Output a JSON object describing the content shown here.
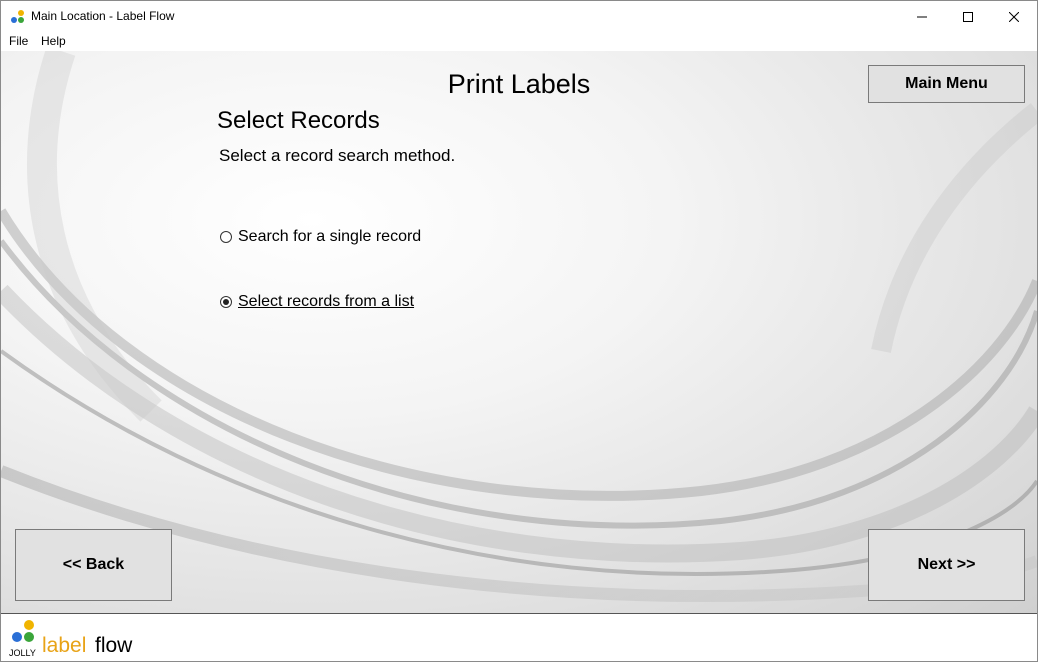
{
  "window": {
    "title": "Main Location - Label Flow"
  },
  "menu": {
    "file": "File",
    "help": "Help"
  },
  "page": {
    "title": "Print Labels",
    "section_title": "Select Records",
    "instruction": "Select a record search method."
  },
  "options": [
    {
      "label": "Search for a single record",
      "checked": false
    },
    {
      "label": "Select records from a list",
      "checked": true
    }
  ],
  "buttons": {
    "main_menu": "Main Menu",
    "back": "<< Back",
    "next": "Next >>"
  },
  "brand": {
    "jolly": "JOLLY",
    "label": "label",
    "flow": "flow",
    "label_color": "#e8a317"
  }
}
